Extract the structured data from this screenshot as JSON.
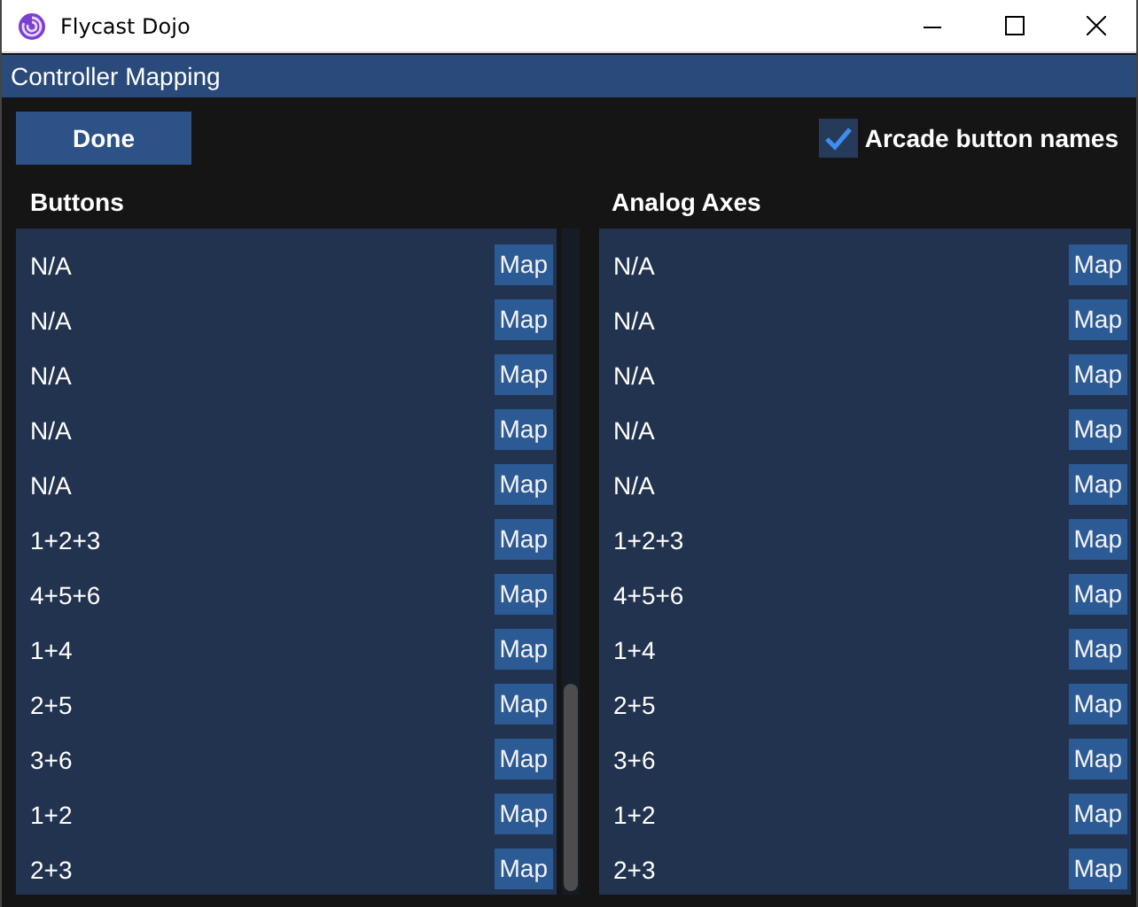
{
  "window": {
    "title": "Flycast Dojo"
  },
  "header": {
    "title": "Controller Mapping"
  },
  "done_button": {
    "label": "Done"
  },
  "arcade_names": {
    "label": "Arcade button names",
    "checked": true
  },
  "buttons": {
    "title": "Buttons",
    "rows": [
      {
        "label": "N/A",
        "action": "Map"
      },
      {
        "label": "N/A",
        "action": "Map"
      },
      {
        "label": "N/A",
        "action": "Map"
      },
      {
        "label": "N/A",
        "action": "Map"
      },
      {
        "label": "N/A",
        "action": "Map"
      },
      {
        "label": "1+2+3",
        "action": "Map"
      },
      {
        "label": "4+5+6",
        "action": "Map"
      },
      {
        "label": "1+4",
        "action": "Map"
      },
      {
        "label": "2+5",
        "action": "Map"
      },
      {
        "label": "3+6",
        "action": "Map"
      },
      {
        "label": "1+2",
        "action": "Map"
      },
      {
        "label": "2+3",
        "action": "Map"
      }
    ]
  },
  "analog_axes": {
    "title": "Analog Axes",
    "rows": [
      {
        "label": "N/A",
        "action": "Map"
      },
      {
        "label": "N/A",
        "action": "Map"
      },
      {
        "label": "N/A",
        "action": "Map"
      },
      {
        "label": "N/A",
        "action": "Map"
      },
      {
        "label": "N/A",
        "action": "Map"
      },
      {
        "label": "1+2+3",
        "action": "Map"
      },
      {
        "label": "4+5+6",
        "action": "Map"
      },
      {
        "label": "1+4",
        "action": "Map"
      },
      {
        "label": "2+5",
        "action": "Map"
      },
      {
        "label": "3+6",
        "action": "Map"
      },
      {
        "label": "1+2",
        "action": "Map"
      },
      {
        "label": "2+3",
        "action": "Map"
      }
    ]
  }
}
